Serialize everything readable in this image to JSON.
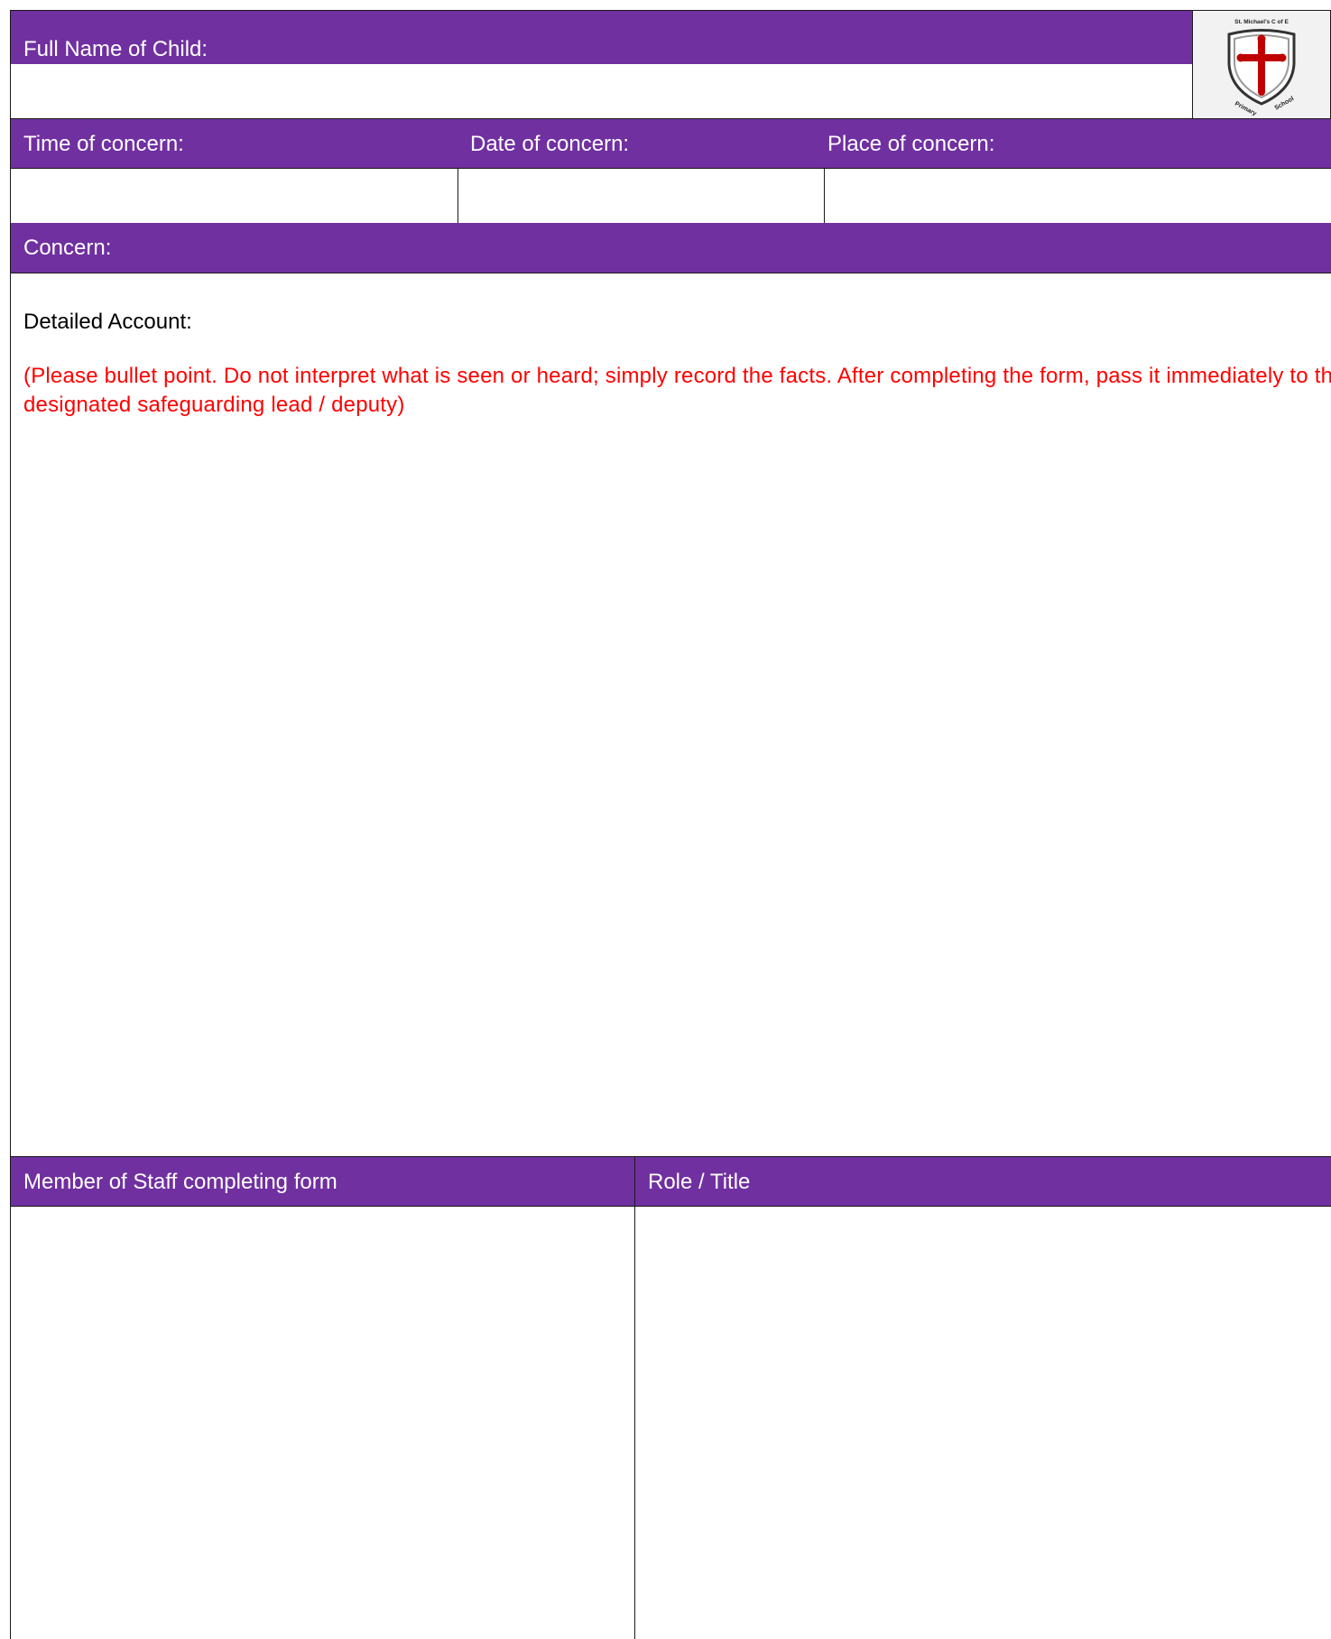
{
  "form": {
    "child_name_label": "Full Name of Child:",
    "time_label": "Time of concern:",
    "date_label": "Date of concern:",
    "place_label": "Place of concern:",
    "concern_label": "Concern:",
    "detailed_title": "Detailed Account:",
    "instructions": "(Please bullet point. Do not interpret what is seen or heard; simply record the facts.  After completing the form, pass it immediately to the designated safeguarding lead / deputy)",
    "staff_label": "Member of Staff completing form",
    "role_label": "Role / Title"
  },
  "logo": {
    "text_top": "St. Michael's C of E",
    "text_left": "Primary",
    "text_right": "School",
    "icon": "shield-cross-icon"
  },
  "colors": {
    "header_purple": "#7030a0",
    "instruction_red": "#ff0000",
    "cross_red": "#c00000"
  }
}
